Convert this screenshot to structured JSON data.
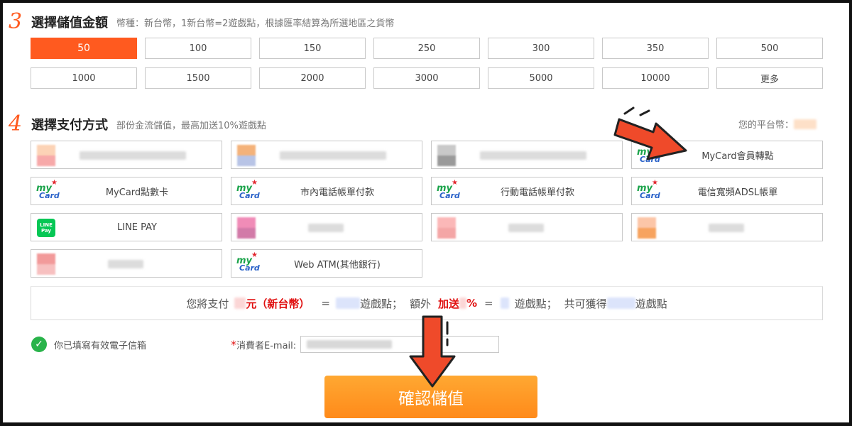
{
  "step3": {
    "number": "3",
    "title": "選擇儲值金額",
    "note": "幣種：新台幣，1新台幣=2遊戲點，根據匯率結算為所選地區之貨幣",
    "amounts": [
      {
        "label": "50",
        "selected": true
      },
      {
        "label": "100"
      },
      {
        "label": "150"
      },
      {
        "label": "250"
      },
      {
        "label": "300"
      },
      {
        "label": "350"
      },
      {
        "label": "500"
      },
      {
        "label": "1000"
      },
      {
        "label": "1500"
      },
      {
        "label": "2000"
      },
      {
        "label": "3000"
      },
      {
        "label": "5000"
      },
      {
        "label": "10000"
      },
      {
        "label": "更多"
      }
    ]
  },
  "step4": {
    "number": "4",
    "title": "選擇支付方式",
    "note": "部份金流儲值，最高加送10%遊戲點",
    "platform_label": "您的平台幣：",
    "methods": [
      {
        "label": "",
        "logo": "blurred-logo"
      },
      {
        "label": "",
        "logo": "blurred-logo"
      },
      {
        "label": "",
        "logo": "blurred-logo"
      },
      {
        "label": "MyCard會員轉點",
        "logo": "mycard-logo"
      },
      {
        "label": "MyCard點數卡",
        "logo": "mycard-logo"
      },
      {
        "label": "市內電話帳單付款",
        "logo": "mycard-logo"
      },
      {
        "label": "行動電話帳單付款",
        "logo": "mycard-logo"
      },
      {
        "label": "電信寬頻ADSL帳單",
        "logo": "mycard-logo"
      },
      {
        "label": "LINE PAY",
        "logo": "line-pay-logo"
      },
      {
        "label": "",
        "logo": "blurred-logo"
      },
      {
        "label": "",
        "logo": "blurred-logo"
      },
      {
        "label": "",
        "logo": "blurred-logo"
      },
      {
        "label": "",
        "logo": "blurred-logo"
      },
      {
        "label": "Web ATM(其他銀行)",
        "logo": "mycard-logo"
      }
    ]
  },
  "summary": {
    "pay_prefix": "您將支付",
    "currency": "元（新台幣）",
    "equals1": "=",
    "points1": "遊戲點；",
    "extra_prefix": "額外",
    "bonus": "加送",
    "percent": "%",
    "equals2": "=",
    "points2": "遊戲點；",
    "total_prefix": "共可獲得",
    "points3": "遊戲點"
  },
  "email": {
    "valid_text": "你已填寫有效電子信箱",
    "required_mark": "*",
    "label": "消費者E-mail:"
  },
  "logos": {
    "mycard_my": "my",
    "mycard_card": "Card",
    "mycard_star": "★",
    "line_top": "LINE",
    "line_bottom": "Pay"
  },
  "confirm_label": "確認儲值",
  "colors": {
    "accent": "#ff5a1f",
    "confirm": "#ff9a26",
    "arrow": "#ef4a2a",
    "highlight": "#e01010",
    "check": "#29b34a"
  }
}
